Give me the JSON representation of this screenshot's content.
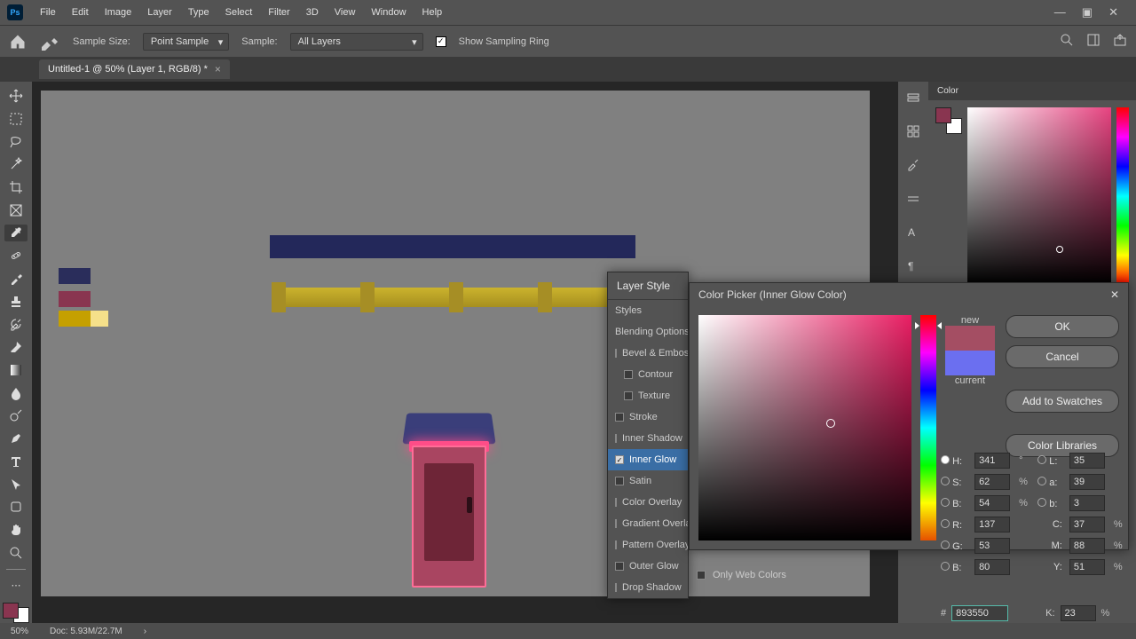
{
  "menu": [
    "File",
    "Edit",
    "Image",
    "Layer",
    "Type",
    "Select",
    "Filter",
    "3D",
    "View",
    "Window",
    "Help"
  ],
  "options": {
    "sample_size_label": "Sample Size:",
    "sample_size_value": "Point Sample",
    "sample_label": "Sample:",
    "sample_value": "All Layers",
    "show_sampling_label": "Show Sampling Ring"
  },
  "tab": {
    "title": "Untitled-1 @ 50% (Layer 1, RGB/8) *"
  },
  "status": {
    "zoom": "50%",
    "doc": "Doc: 5.93M/22.7M"
  },
  "color_panel": {
    "title": "Color"
  },
  "layer_style": {
    "title": "Layer Style",
    "items": [
      {
        "label": "Styles",
        "check": null,
        "indent": 0
      },
      {
        "label": "Blending Options",
        "check": null,
        "indent": 0
      },
      {
        "label": "Bevel & Emboss",
        "check": false,
        "indent": 0
      },
      {
        "label": "Contour",
        "check": false,
        "indent": 1
      },
      {
        "label": "Texture",
        "check": false,
        "indent": 1
      },
      {
        "label": "Stroke",
        "check": false,
        "indent": 0
      },
      {
        "label": "Inner Shadow",
        "check": false,
        "indent": 0
      },
      {
        "label": "Inner Glow",
        "check": true,
        "indent": 0,
        "active": true
      },
      {
        "label": "Satin",
        "check": false,
        "indent": 0
      },
      {
        "label": "Color Overlay",
        "check": false,
        "indent": 0
      },
      {
        "label": "Gradient Overlay",
        "check": false,
        "indent": 0
      },
      {
        "label": "Pattern Overlay",
        "check": false,
        "indent": 0
      },
      {
        "label": "Outer Glow",
        "check": false,
        "indent": 0
      },
      {
        "label": "Drop Shadow",
        "check": false,
        "indent": 0
      }
    ]
  },
  "color_picker": {
    "title": "Color Picker (Inner Glow Color)",
    "new_label": "new",
    "current_label": "current",
    "buttons": {
      "ok": "OK",
      "cancel": "Cancel",
      "add": "Add to Swatches",
      "libs": "Color Libraries"
    },
    "owc": "Only Web Colors",
    "values": {
      "H": "341",
      "S": "62",
      "B": "54",
      "R": "137",
      "G": "53",
      "Bb": "80",
      "L": "35",
      "a": "39",
      "b": "3",
      "C": "37",
      "M": "88",
      "Y": "51",
      "K": "23",
      "hex": "893550"
    },
    "units": {
      "deg": "°",
      "pct": "%"
    }
  },
  "chart_data": {
    "type": "table",
    "note": "not a chart image"
  }
}
